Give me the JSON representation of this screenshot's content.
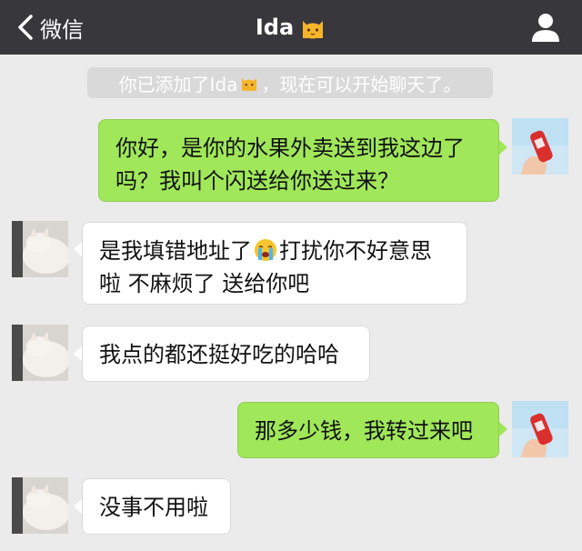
{
  "nav": {
    "back_label": "微信",
    "title": "Ida",
    "title_emoji": "cat-face-emoji"
  },
  "system_note": {
    "before": "你已添加了Ida",
    "emoji": "cat-face-emoji",
    "after": "，现在可以开始聊天了。"
  },
  "messages": [
    {
      "side": "right",
      "text": "你好，是你的水果外卖送到我这边了吗？我叫个闪送给你送过来？",
      "line1": "你好，是你的水果外卖送到我这边了",
      "line2": "吗？我叫个闪送给你送过来？"
    },
    {
      "side": "left",
      "line1_before": "是我填错地址了",
      "emoji": "loudly-crying-face-emoji",
      "line1_after": "打扰你不好意思",
      "line2": "啦 不麻烦了 送给你吧"
    },
    {
      "side": "left",
      "text": "我点的都还挺好吃的哈哈"
    },
    {
      "side": "right",
      "text": "那多少钱，我转过来吧"
    },
    {
      "side": "left",
      "text": "没事不用啦"
    }
  ],
  "colors": {
    "navbar": "#38373c",
    "background": "#ebebeb",
    "bubble_right": "#a0e75a",
    "bubble_left": "#ffffff"
  }
}
